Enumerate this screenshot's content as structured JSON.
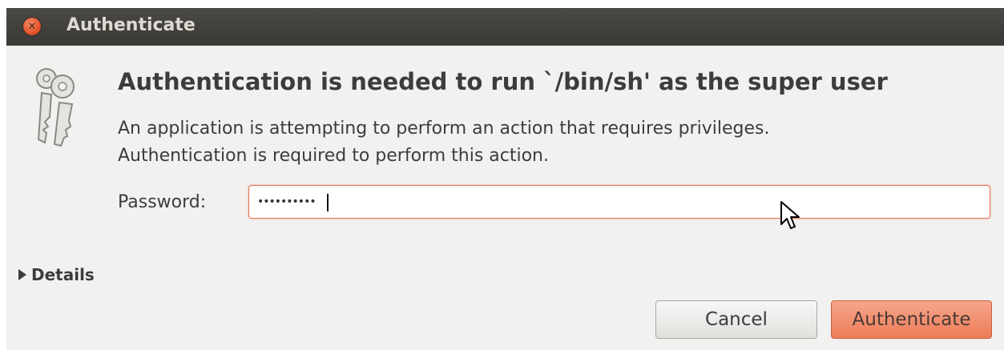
{
  "window": {
    "title": "Authenticate",
    "close_icon": "close-icon"
  },
  "dialog": {
    "icon": "keys-icon",
    "heading": "Authentication is needed to run `/bin/sh' as the super user",
    "message_line1": "An application is attempting to perform an action that requires privileges.",
    "message_line2": "Authentication is required to perform this action.",
    "password_label": "Password:",
    "password_value": "••••••••••",
    "details_label": "Details"
  },
  "buttons": {
    "cancel_label": "Cancel",
    "authenticate_label": "Authenticate"
  },
  "colors": {
    "titlebar": "#3c3b37",
    "accent": "#e6795a",
    "background": "#f2f1f0"
  }
}
